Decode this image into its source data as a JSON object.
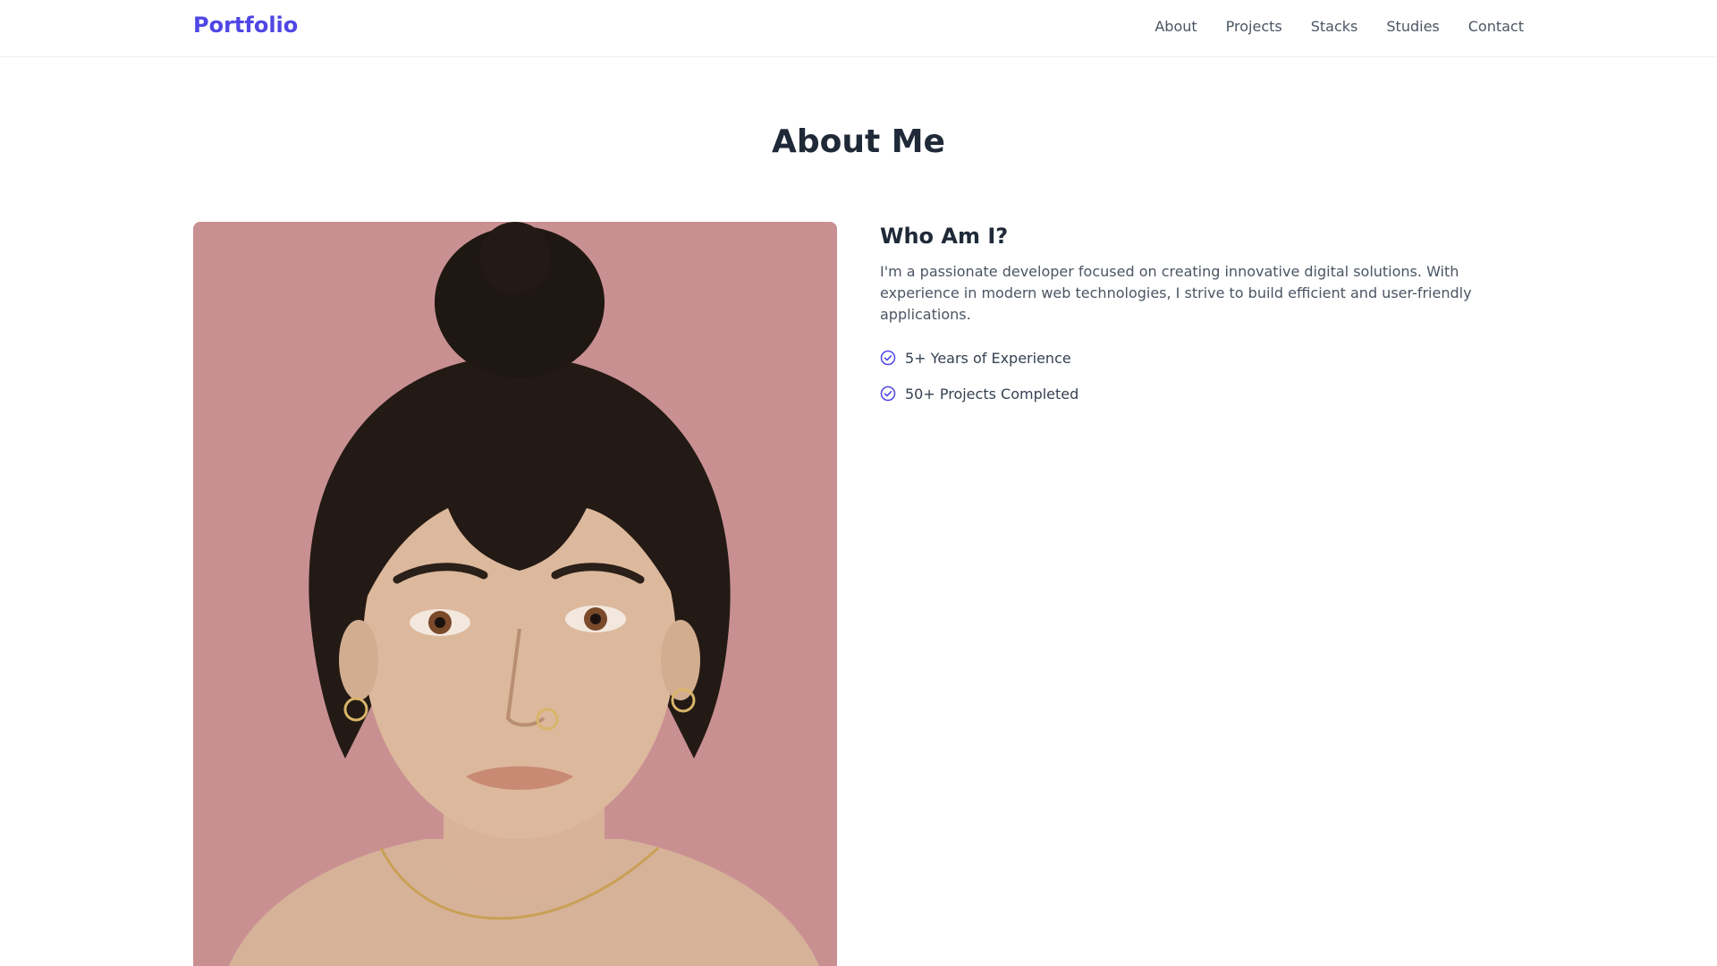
{
  "nav": {
    "brand": "Portfolio",
    "links": [
      {
        "label": "About"
      },
      {
        "label": "Projects"
      },
      {
        "label": "Stacks"
      },
      {
        "label": "Studies"
      },
      {
        "label": "Contact"
      }
    ]
  },
  "about": {
    "title": "About Me",
    "subheading": "Who Am I?",
    "bio": "I'm a passionate developer focused on creating innovative digital solutions. With experience in modern web technologies, I strive to build efficient and user-friendly applications.",
    "facts": [
      {
        "icon": "check-circle-icon",
        "label": "5+ Years of Experience"
      },
      {
        "icon": "check-circle-icon",
        "label": "50+ Projects Completed"
      }
    ]
  },
  "colors": {
    "accent": "#4f46e5",
    "heading": "#1f2937",
    "body_text": "#4b5563",
    "photo_background": "#c99092"
  }
}
